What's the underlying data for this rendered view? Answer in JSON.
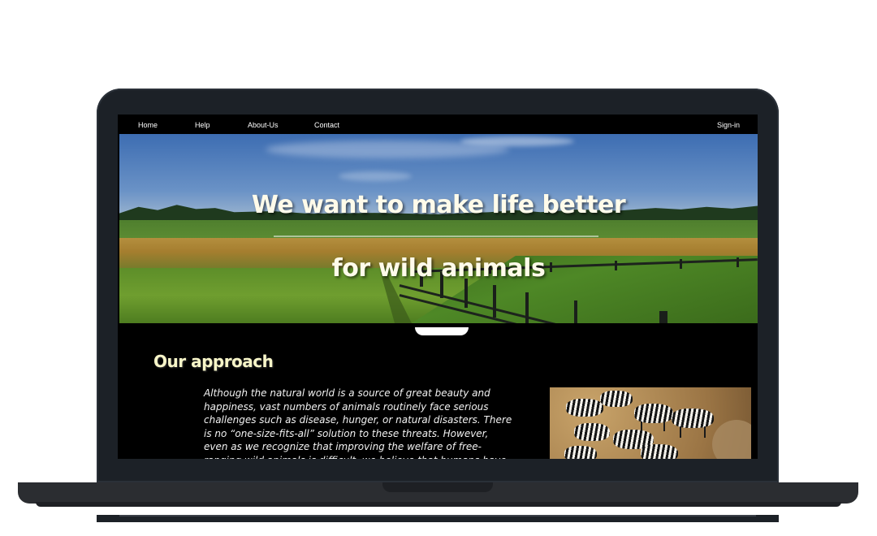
{
  "nav": {
    "items": [
      {
        "label": "Home"
      },
      {
        "label": "Help"
      },
      {
        "label": "About-Us"
      },
      {
        "label": "Contact"
      }
    ],
    "signin_label": "Sign-in"
  },
  "hero": {
    "line1": "We want to make life better",
    "line2": "for wild animals"
  },
  "approach": {
    "title": "Our approach",
    "text": "Although the natural world is a source of great beauty and happiness, vast numbers of animals routinely face serious challenges such as disease, hunger, or natural disasters. There is no “one-size-fits-all” solution to these threats. However, even as we recognize that improving the welfare of free-ranging wild animals is difficult, we believe that humans have a responsibility to help when we can."
  },
  "colors": {
    "title_text": "#fffbea",
    "approach_title": "#f7f5c8",
    "background": "#000000",
    "laptop_frame": "#1c2127"
  },
  "images": {
    "hero": "farm-field-with-fence-image",
    "approach": "zebra-herd-image"
  }
}
